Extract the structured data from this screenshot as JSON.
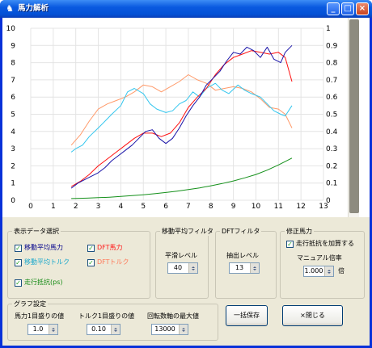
{
  "window": {
    "title": "馬力解析",
    "app_icon": "horse-icon",
    "controls": [
      "minimize-icon",
      "maximize-icon",
      "close-icon"
    ]
  },
  "chart_data": {
    "type": "line",
    "title": "",
    "xlabel": "",
    "ylabel": "",
    "xlim": [
      0,
      13
    ],
    "ylim": [
      0,
      10
    ],
    "y2lim": [
      0,
      1
    ],
    "xticks": [
      "0",
      "1",
      "2",
      "3",
      "4",
      "5",
      "6",
      "7",
      "8",
      "9",
      "10",
      "11",
      "12",
      "13"
    ],
    "yticks": [
      "0",
      "1",
      "2",
      "3",
      "4",
      "5",
      "6",
      "7",
      "8",
      "9",
      "10"
    ],
    "y2ticks": [
      "0",
      "0.1",
      "0.2",
      "0.3",
      "0.4",
      "0.5",
      "0.6",
      "0.7",
      "0.8",
      "0.9",
      "1"
    ],
    "grid": true,
    "series": [
      {
        "color": "#ff9a6a",
        "axis": "left",
        "x": [
          1.8,
          2.2,
          2.6,
          3.0,
          3.4,
          3.8,
          4.2,
          4.6,
          5.0,
          5.4,
          5.8,
          6.2,
          6.6,
          7.0,
          7.4,
          7.8,
          8.2,
          8.6,
          9.0,
          9.4,
          9.8,
          10.2,
          10.6,
          11.0,
          11.3,
          11.6
        ],
        "y": [
          3.2,
          3.8,
          4.6,
          5.3,
          5.6,
          5.8,
          6.0,
          6.3,
          6.7,
          6.6,
          6.3,
          6.6,
          6.9,
          7.3,
          7.0,
          6.8,
          6.4,
          6.5,
          6.6,
          6.5,
          6.3,
          5.9,
          5.4,
          5.3,
          5.0,
          4.2
        ]
      },
      {
        "color": "#33c6ee",
        "axis": "left",
        "x": [
          1.8,
          2.0,
          2.3,
          2.6,
          3.0,
          3.3,
          3.6,
          4.0,
          4.3,
          4.6,
          5.0,
          5.3,
          5.6,
          6.0,
          6.3,
          6.6,
          6.9,
          7.2,
          7.5,
          7.8,
          8.2,
          8.5,
          8.8,
          9.2,
          9.5,
          9.8,
          10.2,
          10.5,
          10.8,
          11.1,
          11.3,
          11.6
        ],
        "y": [
          2.8,
          3.0,
          3.2,
          3.7,
          4.2,
          4.6,
          5.0,
          5.5,
          6.3,
          6.5,
          6.2,
          5.6,
          5.3,
          5.1,
          5.2,
          5.6,
          5.8,
          6.3,
          6.0,
          6.5,
          6.8,
          6.4,
          6.2,
          6.7,
          6.4,
          6.2,
          6.0,
          5.6,
          5.2,
          5.0,
          4.9,
          5.5
        ]
      },
      {
        "color": "#ff1010",
        "axis": "left",
        "x": [
          1.8,
          2.2,
          2.6,
          3.0,
          3.4,
          3.8,
          4.2,
          4.6,
          5.0,
          5.4,
          5.8,
          6.2,
          6.6,
          7.0,
          7.4,
          7.8,
          8.2,
          8.6,
          9.0,
          9.4,
          9.8,
          10.2,
          10.6,
          11.0,
          11.3,
          11.6
        ],
        "y": [
          0.8,
          1.1,
          1.5,
          2.0,
          2.4,
          2.8,
          3.2,
          3.6,
          3.9,
          3.9,
          3.7,
          3.9,
          4.5,
          5.4,
          6.0,
          6.5,
          7.3,
          7.9,
          8.3,
          8.5,
          8.7,
          8.6,
          8.5,
          8.6,
          8.3,
          6.9
        ]
      },
      {
        "color": "#1a14a8",
        "axis": "left",
        "x": [
          1.8,
          2.1,
          2.4,
          2.7,
          3.0,
          3.3,
          3.6,
          3.9,
          4.2,
          4.5,
          4.8,
          5.1,
          5.4,
          5.7,
          6.0,
          6.3,
          6.6,
          6.9,
          7.2,
          7.5,
          7.8,
          8.1,
          8.4,
          8.7,
          9.0,
          9.3,
          9.6,
          9.9,
          10.2,
          10.5,
          10.8,
          11.1,
          11.3,
          11.6
        ],
        "y": [
          0.7,
          1.0,
          1.2,
          1.4,
          1.6,
          1.9,
          2.3,
          2.6,
          2.9,
          3.2,
          3.6,
          4.0,
          4.1,
          3.6,
          3.3,
          3.6,
          4.2,
          4.9,
          5.5,
          6.0,
          6.7,
          7.1,
          7.5,
          8.1,
          8.6,
          8.5,
          8.9,
          8.7,
          8.3,
          8.9,
          8.2,
          8.0,
          8.6,
          9.0
        ]
      },
      {
        "color": "#14901a",
        "axis": "left",
        "x": [
          1.8,
          2.5,
          3.0,
          3.5,
          4.0,
          4.5,
          5.0,
          5.5,
          6.0,
          6.5,
          7.0,
          7.5,
          8.0,
          8.5,
          9.0,
          9.5,
          10.0,
          10.5,
          11.0,
          11.6
        ],
        "y": [
          0.1,
          0.12,
          0.15,
          0.18,
          0.22,
          0.27,
          0.32,
          0.38,
          0.45,
          0.53,
          0.62,
          0.72,
          0.84,
          0.97,
          1.12,
          1.3,
          1.5,
          1.75,
          2.05,
          2.45
        ]
      }
    ]
  },
  "display": {
    "caption": "表示データ選択",
    "items": [
      {
        "label": "移動平均馬力",
        "checked": true,
        "color": "#00008b"
      },
      {
        "label": "移動平均トルク",
        "checked": true,
        "color": "#1aa8cc"
      },
      {
        "label": "DFT馬力",
        "checked": true,
        "color": "#ff1a1a"
      },
      {
        "label": "DFTトルク",
        "checked": true,
        "color": "#ff7a5a"
      },
      {
        "label": "走行抵抗(ps)",
        "checked": true,
        "color": "#138a13"
      }
    ]
  },
  "moving_avg": {
    "caption": "移動平均フィルタ",
    "level_label": "平滑レベル",
    "level_value": "40"
  },
  "dft": {
    "caption": "DFTフィルタ",
    "level_label": "抽出レベル",
    "level_value": "13"
  },
  "correction": {
    "caption": "修正馬力",
    "checkbox_label": "走行抵抗を加算する",
    "checked": true,
    "rate_label": "マニュアル倍率",
    "rate_value": "1.000",
    "rate_unit": "倍"
  },
  "graph": {
    "caption": "グラフ設定",
    "hp_label": "馬力1目盛りの値",
    "hp_value": "1.0",
    "torque_label": "トルク1目盛りの値",
    "torque_value": "0.10",
    "rpm_label": "回転数軸の最大値",
    "rpm_value": "13000"
  },
  "buttons": {
    "save": "一括保存",
    "close": "×閉じる"
  }
}
